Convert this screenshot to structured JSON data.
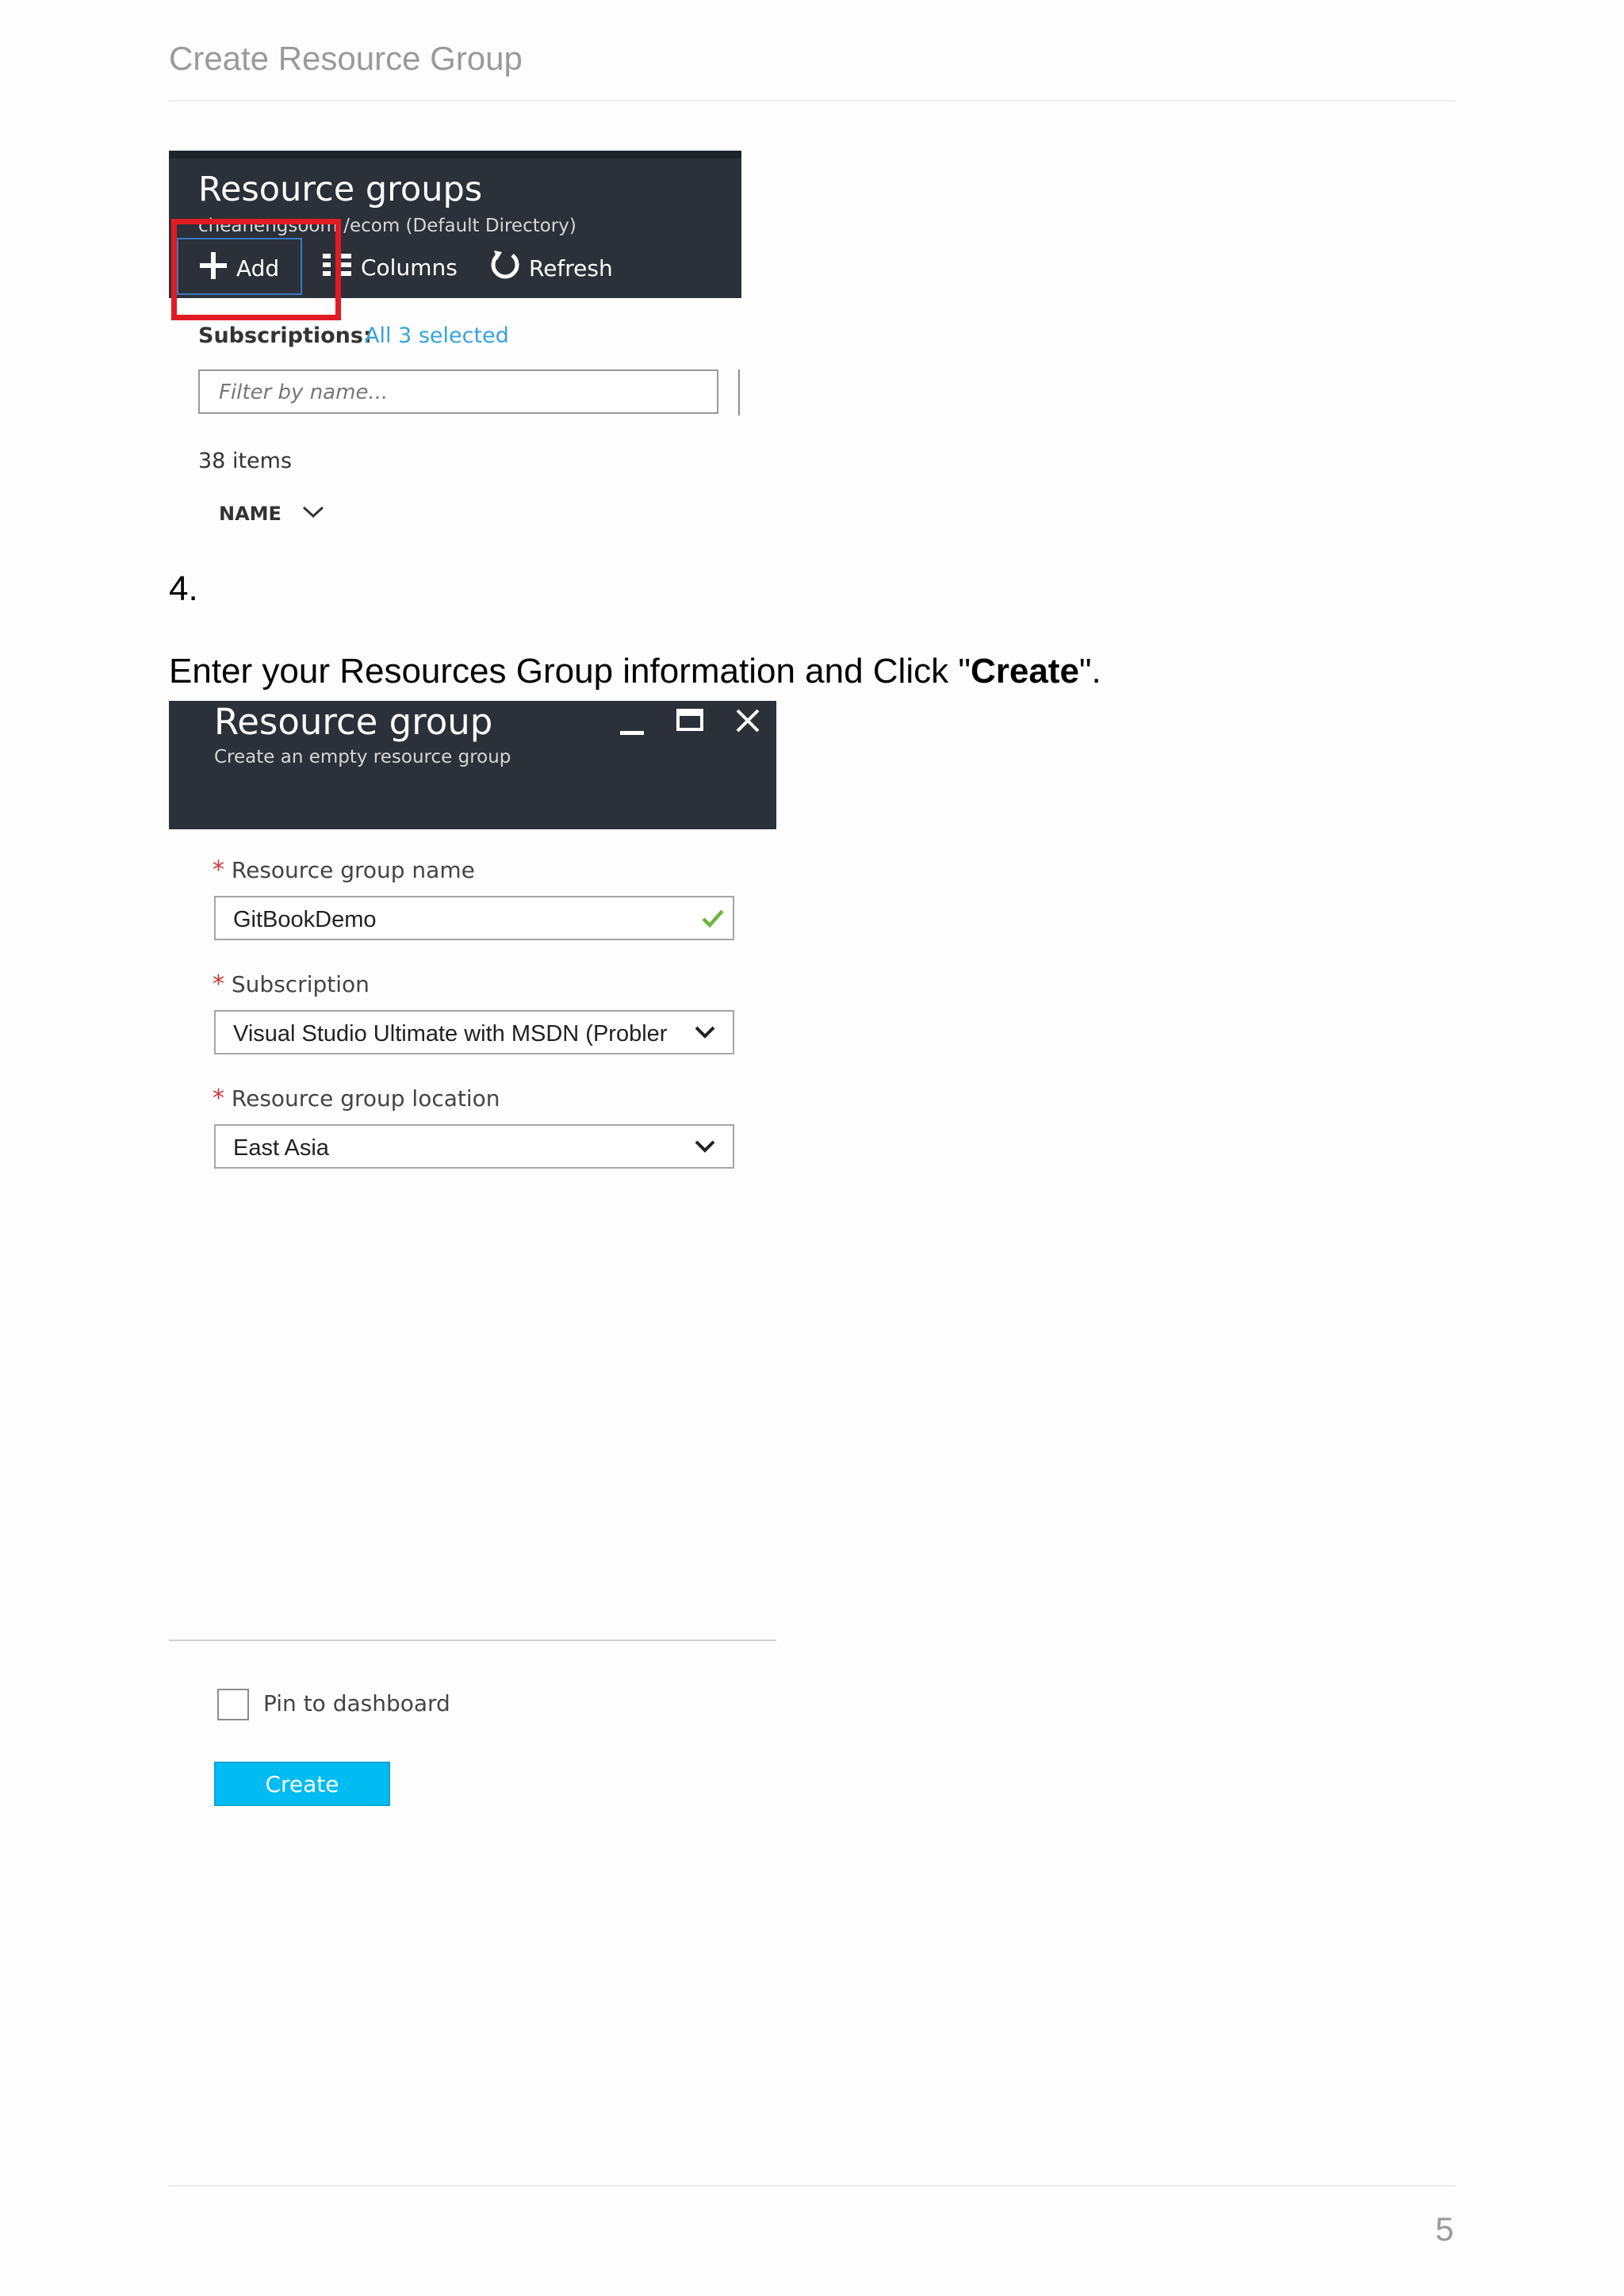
{
  "page": {
    "header_title": "Create Resource Group",
    "page_number": "5"
  },
  "resource_groups_blade": {
    "title": "Resource groups",
    "subtitle": "cheanengsoom /ecom (Default Directory)",
    "commands": [
      {
        "label": "Add",
        "icon": "plus-icon"
      },
      {
        "label": "Columns",
        "icon": "columns-icon"
      },
      {
        "label": "Refresh",
        "icon": "refresh-icon"
      }
    ],
    "subscriptions_label": "Subscriptions:",
    "subscriptions_value": "All 3 selected",
    "filter_placeholder": "Filter by name...",
    "item_count": "38 items",
    "column_header": "NAME",
    "highlight_color": "#e01b24"
  },
  "step": {
    "number": "4.",
    "instruction_prefix": "Enter your Resources Group information and Click \"",
    "instruction_bold": "Create",
    "instruction_suffix": "\"."
  },
  "resource_group_blade": {
    "title": "Resource group",
    "subtitle": "Create an empty resource group",
    "window_controls": [
      "minimize-icon",
      "maximize-icon",
      "close-icon"
    ],
    "fields": [
      {
        "label": "Resource group name",
        "required_mark": "*",
        "value": "GitBookDemo",
        "status_icon": "checkmark-icon"
      },
      {
        "label": "Subscription",
        "required_mark": "*",
        "value": "Visual Studio Ultimate with MSDN (Probler",
        "control": "dropdown"
      },
      {
        "label": "Resource group location",
        "required_mark": "*",
        "value": "East Asia",
        "control": "dropdown"
      }
    ],
    "pin_label": "Pin to dashboard",
    "pin_checked": false,
    "create_label": "Create",
    "accent_color": "#00bcf2",
    "header_color": "#2b3039"
  }
}
